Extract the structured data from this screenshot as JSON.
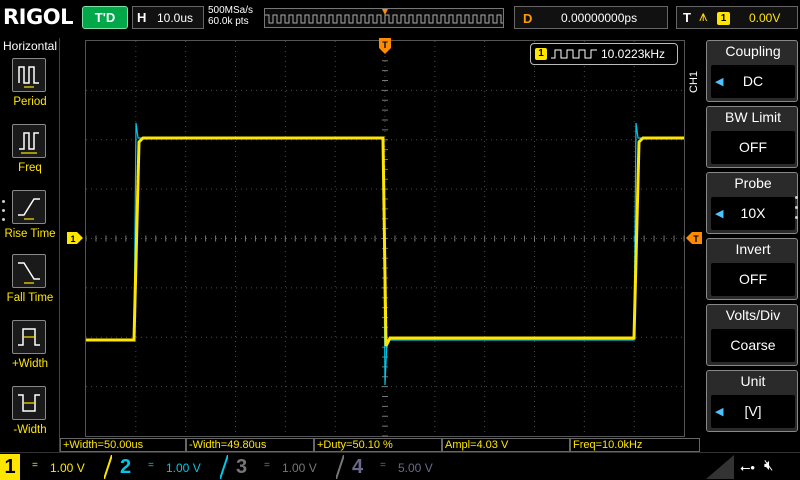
{
  "topbar": {
    "brand": "RIGOL",
    "run_status": "T'D",
    "timebase_label": "H",
    "timebase_value": "10.0us",
    "sample_rate": "500MSa/s",
    "memory_depth": "60.0k pts",
    "delay_label": "D",
    "delay_value": "0.00000000ps",
    "trigger_label": "T",
    "trigger_channel": "1",
    "trigger_level": "0.00V"
  },
  "sidebar": {
    "title": "Horizontal",
    "items": [
      {
        "label": "Period",
        "icon": "period-icon"
      },
      {
        "label": "Freq",
        "icon": "freq-icon"
      },
      {
        "label": "Rise Time",
        "icon": "rise-time-icon"
      },
      {
        "label": "Fall Time",
        "icon": "fall-time-icon"
      },
      {
        "label": "+Width",
        "icon": "pos-width-icon"
      },
      {
        "label": "-Width",
        "icon": "neg-width-icon"
      }
    ]
  },
  "screen": {
    "frequency_counter_channel": "1",
    "frequency_counter_value": "10.0223kHz",
    "channel_tab": "CH1",
    "trigger_marker": "T",
    "ch1_marker": "1"
  },
  "measurements": [
    "+Width=50.00us",
    "-Width=49.80us",
    "+Duty=50.10 %",
    "Ampl=4.03 V",
    "Freq=10.0kHz"
  ],
  "menu": {
    "items": [
      {
        "title": "Coupling",
        "value": "DC"
      },
      {
        "title": "BW Limit",
        "value": "OFF"
      },
      {
        "title": "Probe",
        "value": "10X"
      },
      {
        "title": "Invert",
        "value": "OFF"
      },
      {
        "title": "Volts/Div",
        "value": "Coarse"
      },
      {
        "title": "Unit",
        "value": "[V]"
      }
    ]
  },
  "channels": [
    {
      "number": "1",
      "coupling": "=",
      "scale": "1.00 V"
    },
    {
      "number": "2",
      "coupling": "=",
      "scale": "1.00 V"
    },
    {
      "number": "3",
      "coupling": "=",
      "scale": "1.00 V"
    },
    {
      "number": "4",
      "coupling": "=",
      "scale": "5.00 V"
    }
  ],
  "colors": {
    "ch1": "#ffe600",
    "ch2": "#00c8e8",
    "grid": "#4a4a4a",
    "trigger": "#ff8c00"
  }
}
